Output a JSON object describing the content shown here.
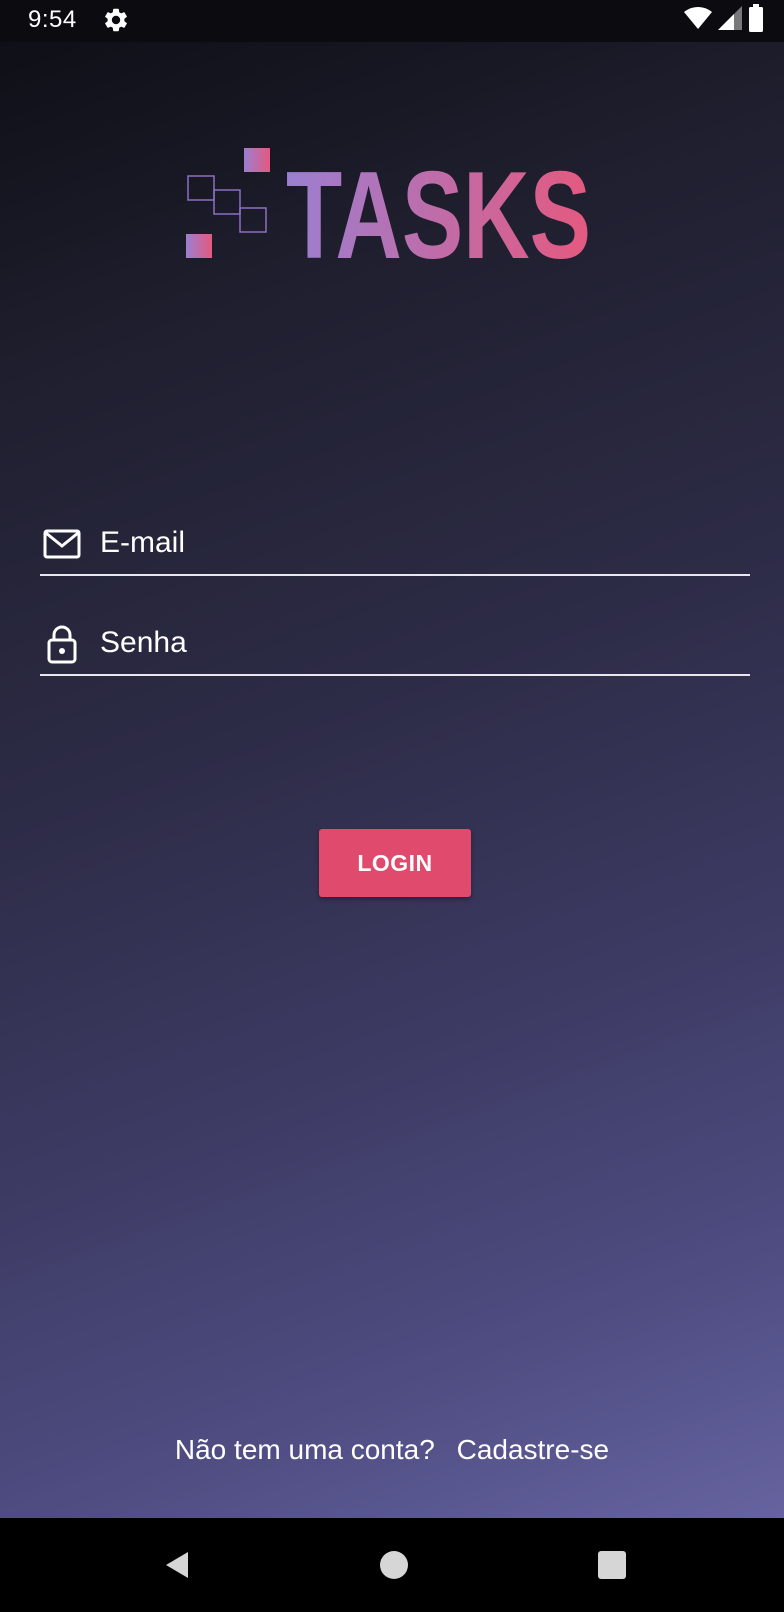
{
  "status_bar": {
    "time": "9:54",
    "settings_icon": "gear-icon",
    "wifi_icon": "wifi-icon",
    "signal_icon": "cell-signal-icon",
    "battery_icon": "battery-icon"
  },
  "logo": {
    "text": "TASKS",
    "gradient_start": "#9b7fd1",
    "gradient_end": "#e5597f"
  },
  "form": {
    "email": {
      "icon": "mail-icon",
      "placeholder": "E-mail",
      "value": ""
    },
    "password": {
      "icon": "lock-icon",
      "placeholder": "Senha",
      "value": ""
    },
    "login_label": "LOGIN"
  },
  "signup": {
    "prompt": "Não tem uma conta?",
    "link_label": "Cadastre-se"
  },
  "nav_bar": {
    "back_icon": "back-icon",
    "home_icon": "home-icon",
    "recents_icon": "recents-icon"
  },
  "colors": {
    "accent": "#e04a6c",
    "background_top": "#0f0f17",
    "background_bottom": "#6663a0",
    "text": "#ffffff"
  }
}
